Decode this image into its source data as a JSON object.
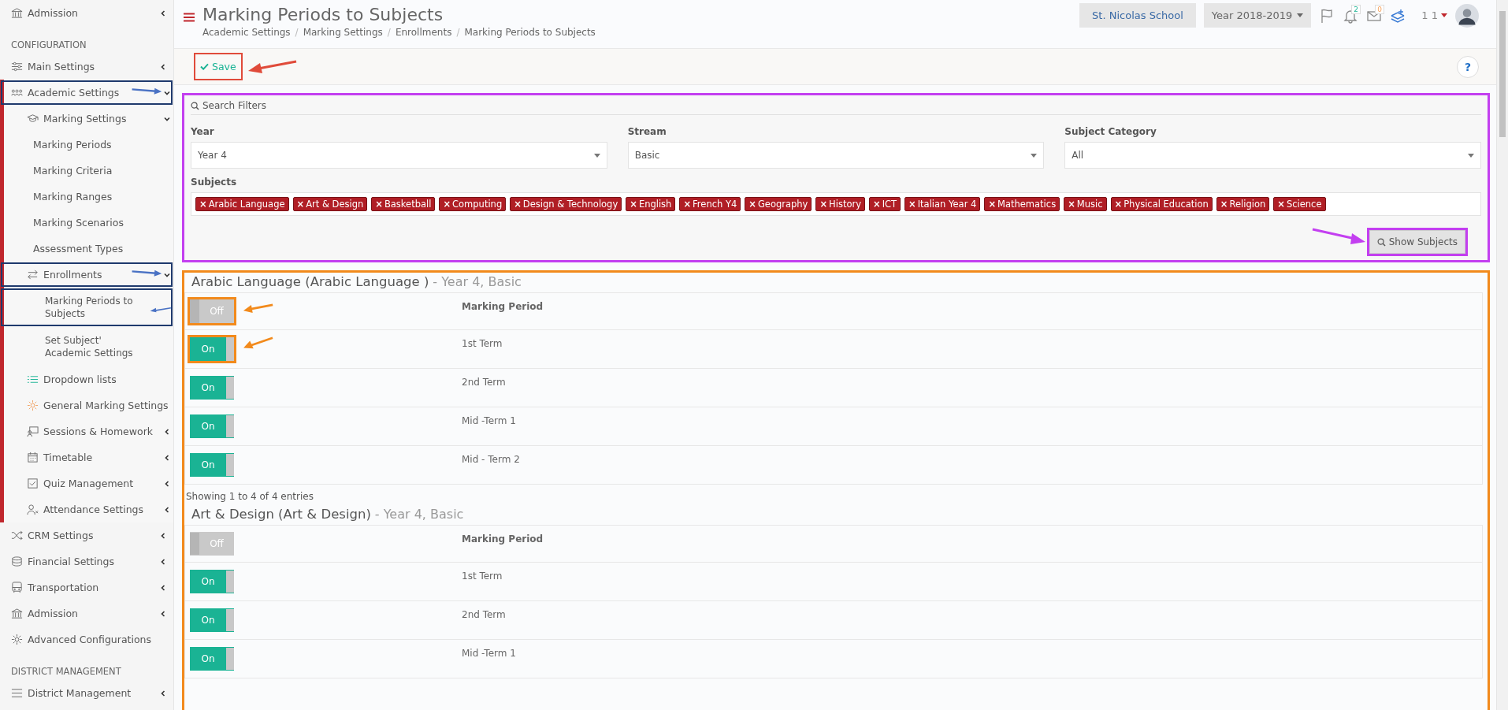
{
  "sidebar": {
    "items": [
      {
        "kind": "item",
        "label": "Admission",
        "expanded": false
      },
      {
        "kind": "header",
        "label": "CONFIGURATION"
      },
      {
        "kind": "item",
        "label": "Main Settings",
        "expanded": false
      },
      {
        "kind": "item",
        "label": "Academic Settings",
        "expanded": true,
        "annotated": true,
        "children": [
          {
            "label": "Marking Settings",
            "expanded": true,
            "children": [
              {
                "label": "Marking Periods"
              },
              {
                "label": "Marking Criteria"
              },
              {
                "label": "Marking Ranges"
              },
              {
                "label": "Marking Scenarios"
              },
              {
                "label": "Assessment Types"
              }
            ]
          },
          {
            "label": "Enrollments",
            "expanded": true,
            "annotated": true,
            "children": [
              {
                "label": "Marking Periods to Subjects",
                "annotated": true
              },
              {
                "label": "Set Subject' Academic Settings"
              }
            ]
          },
          {
            "label": "Dropdown lists"
          },
          {
            "label": "General Marking Settings"
          },
          {
            "label": "Sessions & Homework",
            "expanded": false
          },
          {
            "label": "Timetable",
            "expanded": false
          },
          {
            "label": "Quiz Management",
            "expanded": false
          },
          {
            "label": "Attendance Settings",
            "expanded": false
          }
        ]
      },
      {
        "kind": "item",
        "label": "CRM Settings",
        "expanded": false
      },
      {
        "kind": "item",
        "label": "Financial Settings",
        "expanded": false
      },
      {
        "kind": "item",
        "label": "Transportation",
        "expanded": false
      },
      {
        "kind": "item",
        "label": "Admission",
        "expanded": false
      },
      {
        "kind": "item",
        "label": "Advanced Configurations"
      },
      {
        "kind": "header",
        "label": "DISTRICT MANAGEMENT"
      },
      {
        "kind": "item",
        "label": "District Management",
        "expanded": false
      }
    ]
  },
  "header": {
    "title": "Marking Periods to Subjects",
    "breadcrumb": [
      "Academic Settings",
      "Marking Settings",
      "Enrollments",
      "Marking Periods to Subjects"
    ],
    "breadcrumb_separator": "/",
    "school": "St. Nicolas School",
    "year": "Year 2018-2019",
    "notifications": "2",
    "messages": "0",
    "user": "1 1"
  },
  "toolbar": {
    "save": {
      "label": "Save",
      "annotated": true
    },
    "help": "?"
  },
  "filters": {
    "legend": "Search Filters",
    "annotated": true,
    "fields": [
      {
        "label": "Year",
        "value": "Year 4"
      },
      {
        "label": "Stream",
        "value": "Basic"
      },
      {
        "label": "Subject Category",
        "value": "All"
      }
    ],
    "subjects_label": "Subjects",
    "tag_remove": "×",
    "subjects": [
      "Arabic Language",
      "Art & Design",
      "Basketball",
      "Computing",
      "Design & Technology",
      "English",
      "French Y4",
      "Geography",
      "History",
      "ICT",
      "Italian Year 4",
      "Mathematics",
      "Music",
      "Physical Education",
      "Religion",
      "Science"
    ],
    "show_button": {
      "label": "Show Subjects",
      "annotated": true
    }
  },
  "results": {
    "annotated": true,
    "sections": [
      {
        "title": "Arabic Language (Arabic Language )",
        "subtitle": "- Year 4, Basic",
        "column": "Marking Period",
        "header_toggle": {
          "on": false,
          "label": "Off",
          "annotated": true
        },
        "rows": [
          {
            "label": "1st Term",
            "on": true,
            "toggle": "On",
            "annotated": true
          },
          {
            "label": "2nd Term",
            "on": true,
            "toggle": "On",
            "annotated": false
          },
          {
            "label": "Mid -Term 1",
            "on": true,
            "toggle": "On",
            "annotated": false
          },
          {
            "label": "Mid - Term 2",
            "on": true,
            "toggle": "On",
            "annotated": false
          }
        ],
        "footer": "Showing 1 to 4 of 4 entries"
      },
      {
        "title": "Art & Design (Art & Design)",
        "subtitle": "- Year 4, Basic",
        "column": "Marking Period",
        "header_toggle": {
          "on": false,
          "label": "Off",
          "annotated": false
        },
        "rows": [
          {
            "label": "1st Term",
            "on": true,
            "toggle": "On",
            "annotated": false
          },
          {
            "label": "2nd Term",
            "on": true,
            "toggle": "On",
            "annotated": false
          },
          {
            "label": "Mid -Term 1",
            "on": true,
            "toggle": "On",
            "annotated": false
          }
        ]
      }
    ]
  }
}
